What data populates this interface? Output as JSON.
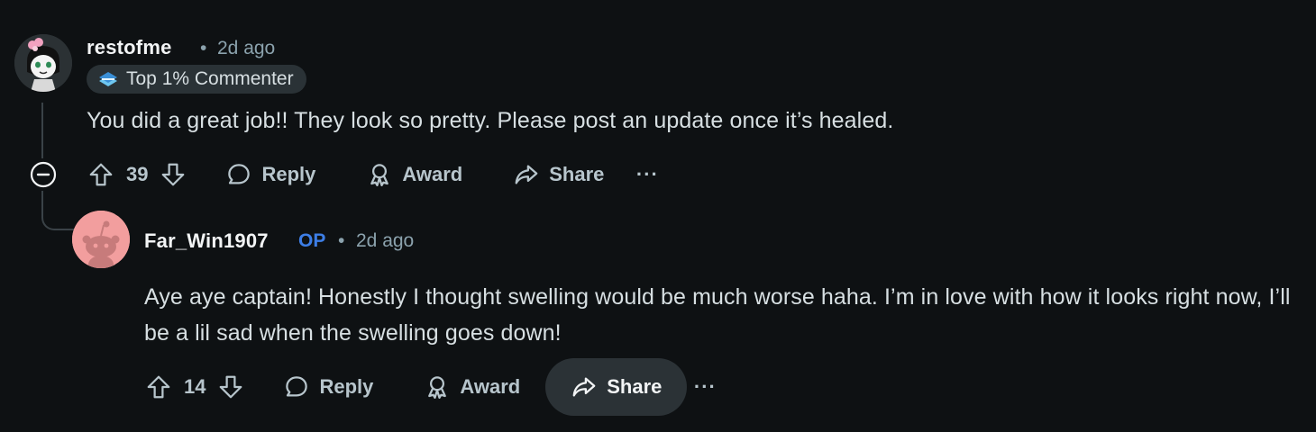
{
  "comments": [
    {
      "author": "restofme",
      "separator": "•",
      "time": "2d ago",
      "badge": {
        "icon": "top-commenter-icon",
        "label": "Top 1% Commenter"
      },
      "body": "You did a great job!! They look so pretty. Please post an update once it’s healed.",
      "score": "39",
      "actions": {
        "reply": "Reply",
        "award": "Award",
        "share": "Share",
        "more": "···"
      }
    },
    {
      "author": "Far_Win1907",
      "op_label": "OP",
      "separator": "•",
      "time": "2d ago",
      "body": "Aye aye captain! Honestly I thought swelling would be much worse haha. I’m in love with how it looks right now, I’ll be a lil sad when the swelling goes down!",
      "score": "14",
      "actions": {
        "reply": "Reply",
        "award": "Award",
        "share": "Share",
        "more": "···"
      }
    }
  ],
  "colors": {
    "background": "#0e1113",
    "op": "#3d7ee6",
    "active_action_bg": "#2b3236",
    "avatar_2_bg": "#f29e9e"
  }
}
